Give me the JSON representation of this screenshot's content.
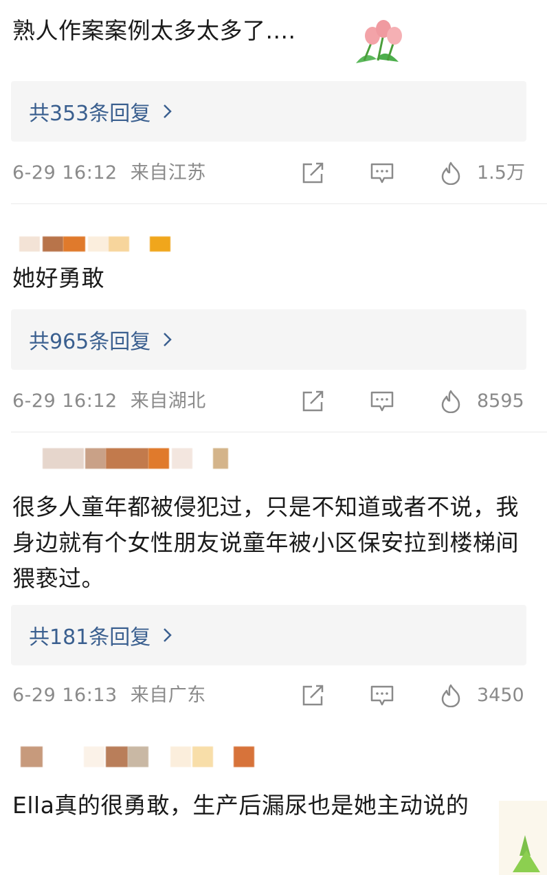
{
  "comments": [
    {
      "text": "熟人作案案例太多太多了....",
      "reply_link": "共353条回复",
      "time": "6-29 16:12",
      "location": "来自江苏",
      "likes": "1.5万"
    },
    {
      "text": "她好勇敢",
      "reply_link": "共965条回复",
      "time": "6-29 16:12",
      "location": "来自湖北",
      "likes": "8595"
    },
    {
      "text": "很多人童年都被侵犯过，只是不知道或者不说，我身边就有个女性朋友说童年被小区保安拉到楼梯间猥亵过。",
      "reply_link": "共181条回复",
      "time": "6-29 16:13",
      "location": "来自广东",
      "likes": "3450"
    },
    {
      "text": "Ella真的很勇敢，生产后漏尿也是她主动说的"
    }
  ],
  "icons": {
    "chevron": "chevron-right-icon",
    "share": "share-icon",
    "reply": "comment-icon",
    "like": "fire-icon",
    "flower": "tulip-emoji",
    "sticker": "sticker-emoji"
  },
  "colors": {
    "reply_link": "#3a5f8f",
    "meta_text": "#8a8a8a",
    "reply_bg": "#f5f5f5"
  }
}
